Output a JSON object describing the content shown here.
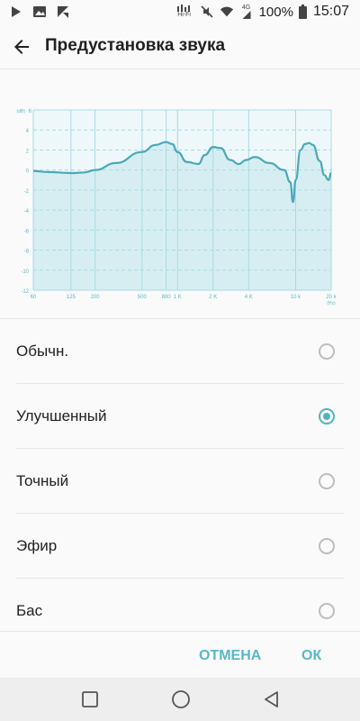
{
  "status_bar": {
    "battery_text": "100%",
    "time": "15:07",
    "hifi_label": "Hi-Fi",
    "net_label": "4G",
    "icons": [
      "play-icon",
      "gallery-icon",
      "app-notify-icon",
      "hifi-icon",
      "mute-icon",
      "wifi-icon",
      "signal-icon",
      "battery-icon"
    ]
  },
  "header": {
    "title": "Предустановка звука",
    "back_icon": "arrow-back-icon"
  },
  "colors": {
    "accent": "#4fb3c3",
    "button_text": "#5ab7c6",
    "chart_fill": "#d6eef2",
    "chart_grid": "#a9dbe3",
    "chart_line": "#4aa8b7"
  },
  "chart_data": {
    "type": "area",
    "y_unit": "(dB)",
    "y_ticks": [
      "6",
      "4",
      "2",
      "0",
      "-2",
      "-4",
      "-6",
      "-8",
      "-10",
      "-12"
    ],
    "x_ticks": [
      "60",
      "125",
      "200",
      "500",
      "800",
      "1 K",
      "2 K",
      "4 K",
      "10 k",
      "20 k"
    ],
    "x_unit": "(Hz)",
    "ylim": [
      -12,
      6
    ],
    "grid": true,
    "series": [
      {
        "points": [
          [
            60,
            -0.1
          ],
          [
            80,
            -0.2
          ],
          [
            125,
            -0.3
          ],
          [
            160,
            -0.25
          ],
          [
            200,
            0.0
          ],
          [
            300,
            0.7
          ],
          [
            500,
            1.8
          ],
          [
            650,
            2.5
          ],
          [
            800,
            2.8
          ],
          [
            900,
            2.6
          ],
          [
            1000,
            1.8
          ],
          [
            1200,
            0.8
          ],
          [
            1500,
            0.6
          ],
          [
            1700,
            1.5
          ],
          [
            2000,
            2.3
          ],
          [
            2300,
            2.2
          ],
          [
            2800,
            1.0
          ],
          [
            3300,
            0.6
          ],
          [
            3800,
            1.0
          ],
          [
            4500,
            1.3
          ],
          [
            6000,
            0.7
          ],
          [
            8000,
            0.0
          ],
          [
            9000,
            -1.2
          ],
          [
            9500,
            -3.2
          ],
          [
            10000,
            -1.0
          ],
          [
            11000,
            2.0
          ],
          [
            12000,
            2.6
          ],
          [
            13000,
            2.7
          ],
          [
            14000,
            2.5
          ],
          [
            16000,
            0.9
          ],
          [
            17500,
            -0.5
          ],
          [
            19000,
            -1.0
          ],
          [
            20000,
            -0.3
          ]
        ]
      }
    ]
  },
  "presets": [
    {
      "label": "Обычн.",
      "selected": false
    },
    {
      "label": "Улучшенный",
      "selected": true
    },
    {
      "label": "Точный",
      "selected": false
    },
    {
      "label": "Эфир",
      "selected": false
    },
    {
      "label": "Бас",
      "selected": false
    }
  ],
  "buttons": {
    "cancel": "ОТМЕНА",
    "ok": "ОК"
  },
  "nav": {
    "icons": [
      "recents-square-icon",
      "home-circle-icon",
      "back-triangle-icon"
    ]
  }
}
